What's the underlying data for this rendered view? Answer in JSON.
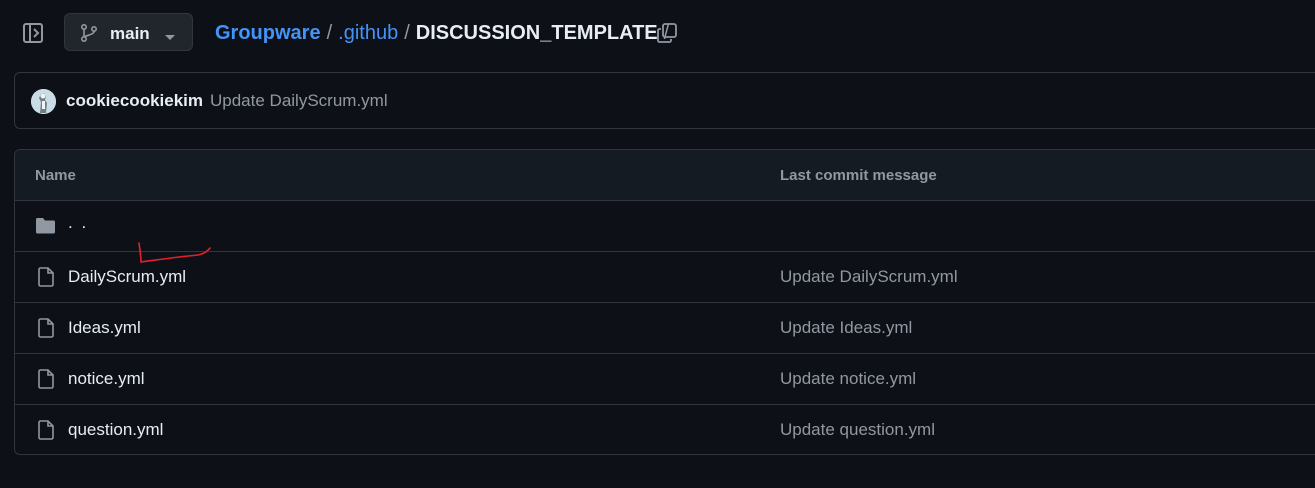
{
  "header": {
    "branch": {
      "label": "main",
      "icon": "git-branch-icon"
    },
    "breadcrumb": {
      "repo": "Groupware",
      "folder": ".github",
      "current": "DISCUSSION_TEMPLATE",
      "separator": "/"
    },
    "icons": {
      "sidebar_toggle": "sidebar-expand-icon",
      "copy": "copy-icon",
      "caret": "triangle-down-icon"
    }
  },
  "latest_commit": {
    "author": "cookiecookiekim",
    "message": "Update DailyScrum.yml"
  },
  "table": {
    "headers": {
      "name": "Name",
      "last_commit": "Last commit message"
    },
    "parent": {
      "label": ". ."
    },
    "files": [
      {
        "name": "DailyScrum.yml",
        "commit": "Update DailyScrum.yml"
      },
      {
        "name": "Ideas.yml",
        "commit": "Update Ideas.yml"
      },
      {
        "name": "notice.yml",
        "commit": "Update notice.yml"
      },
      {
        "name": "question.yml",
        "commit": "Update question.yml"
      }
    ]
  },
  "colors": {
    "background": "#0d1117",
    "border": "#30363d",
    "link": "#4493f8",
    "muted": "#9198a1",
    "text": "#e6edf3",
    "annotation": "#e5202b"
  }
}
